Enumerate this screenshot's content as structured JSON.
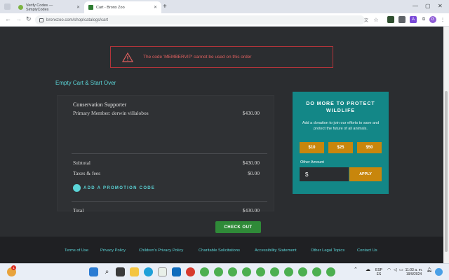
{
  "browser": {
    "tabs": [
      {
        "title": "Verify Codes — SimplyCodes",
        "active": false
      },
      {
        "title": "Cart - Bronx Zoo",
        "active": true
      }
    ],
    "new_tab_symbol": "+",
    "url": "bronxzoo.com/shop/catalogs/cart",
    "profile_initial": "G"
  },
  "alert": {
    "message": "The code 'MEMBERVIP' cannot be used on this order",
    "color": "#e0605f"
  },
  "cart": {
    "empty_link": "Empty Cart & Start Over",
    "item_title": "Conservation Supporter",
    "item_member": "Primary Member: derwin villalobos",
    "item_price": "$430.00",
    "subtotal_label": "Subtotal",
    "subtotal_value": "$430.00",
    "taxes_label": "Taxes & fees",
    "taxes_value": "$0.00",
    "promo_label": "ADD A PROMOTION CODE",
    "total_label": "Total",
    "total_value": "$430.00",
    "checkout_label": "CHECK OUT"
  },
  "donation": {
    "title": "DO MORE TO PROTECT WILDLIFE",
    "description": "Add a donation to join our efforts to save and protect the future of all animals.",
    "amounts": [
      "$10",
      "$25",
      "$50"
    ],
    "other_label": "Other Amount",
    "currency_symbol": "$",
    "apply_label": "APPLY"
  },
  "footer": {
    "links": [
      "Terms of Use",
      "Privacy Policy",
      "Children's Privacy Policy",
      "Charitable Solicitations",
      "Accessibility Statement",
      "Other Legal Topics",
      "Contact Us"
    ]
  },
  "taskbar": {
    "language": "ESP",
    "region": "ES",
    "time": "11:03 a. m.",
    "date": "19/9/2024",
    "notification_count": "1"
  },
  "colors": {
    "accent_teal": "#5bd5d8",
    "donate_bg": "#138787",
    "donate_button": "#c8860c",
    "checkout_green": "#2f8a38"
  }
}
